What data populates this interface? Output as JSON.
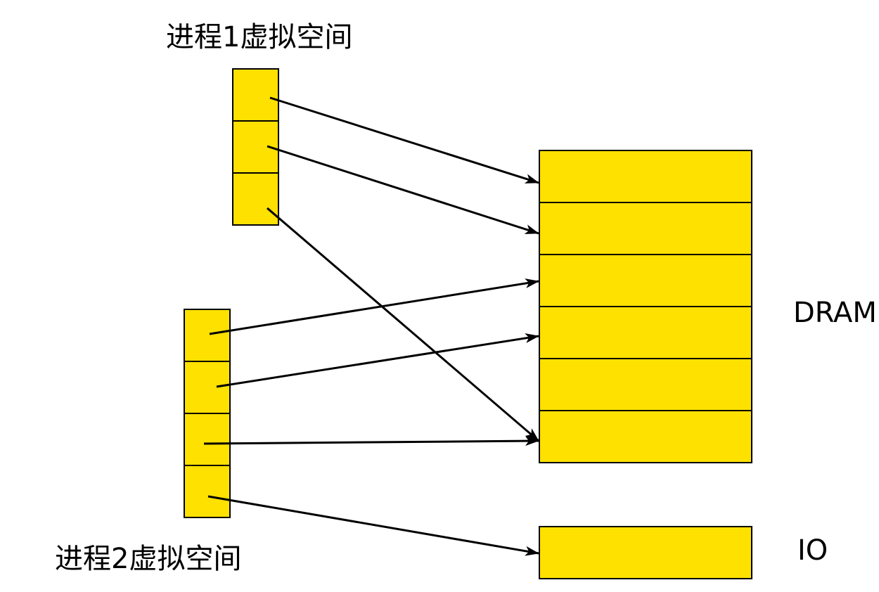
{
  "labels": {
    "process1": "进程1虚拟空间",
    "process2": "进程2虚拟空间",
    "dram": "DRAM",
    "io": "IO"
  },
  "colors": {
    "block_fill": "#FFE100",
    "stroke": "#000000"
  },
  "process1_pages": 3,
  "process2_pages": 4,
  "dram_frames": 6,
  "io_frames": 1,
  "mappings": [
    {
      "from": "process1",
      "page": 1,
      "to": "dram",
      "frame": 1
    },
    {
      "from": "process1",
      "page": 2,
      "to": "dram",
      "frame": 2
    },
    {
      "from": "process1",
      "page": 3,
      "to": "dram",
      "frame": 6
    },
    {
      "from": "process2",
      "page": 1,
      "to": "dram",
      "frame": 3
    },
    {
      "from": "process2",
      "page": 2,
      "to": "dram",
      "frame": 4
    },
    {
      "from": "process2",
      "page": 3,
      "to": "dram",
      "frame": 6
    },
    {
      "from": "process2",
      "page": 4,
      "to": "io",
      "frame": 1
    }
  ]
}
